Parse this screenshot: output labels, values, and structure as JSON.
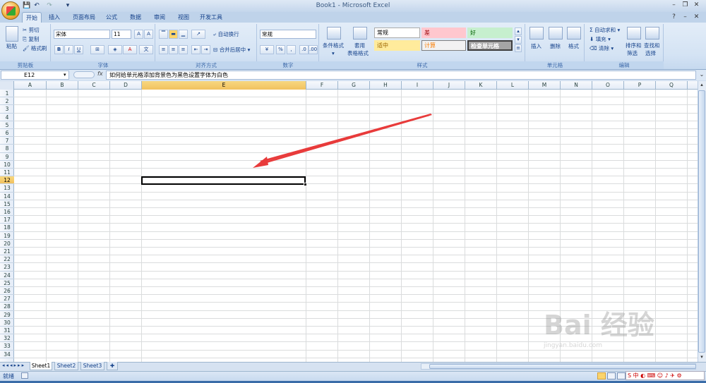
{
  "window": {
    "title": "Book1 - Microsoft Excel"
  },
  "tabs": [
    "开始",
    "插入",
    "页面布局",
    "公式",
    "数据",
    "审阅",
    "视图",
    "开发工具"
  ],
  "clipboard": {
    "paste": "粘贴",
    "cut": "剪切",
    "copy": "复制",
    "format_painter": "格式刷",
    "group_label": "剪贴板"
  },
  "font": {
    "name": "宋体",
    "size": "11",
    "bold": "B",
    "italic": "I",
    "underline": "U",
    "group_label": "字体"
  },
  "alignment": {
    "wrap_text": "自动换行",
    "merge_center": "合并后居中",
    "group_label": "对齐方式"
  },
  "number": {
    "format": "常规",
    "percent": "%",
    "comma": ",",
    "group_label": "数字"
  },
  "styles": {
    "conditional": "条件格式",
    "table_format_1": "套用",
    "table_format_2": "表格格式",
    "cells": [
      "常规",
      "差",
      "好",
      "适中",
      "计算",
      "检查单元格"
    ],
    "group_label": "样式"
  },
  "cells_group": {
    "insert": "插入",
    "delete": "删除",
    "format": "格式",
    "group_label": "单元格"
  },
  "editing": {
    "autosum": "自动求和",
    "fill": "填充",
    "clear": "清除",
    "sort_1": "排序和",
    "sort_2": "筛选",
    "find_1": "查找和",
    "find_2": "选择",
    "group_label": "编辑"
  },
  "formula_bar": {
    "name_box": "E12",
    "fx": "fx",
    "content": "如何给单元格添加背景色为黑色设置字体为白色"
  },
  "columns": [
    "A",
    "B",
    "C",
    "D",
    "E",
    "F",
    "G",
    "H",
    "I",
    "J",
    "K",
    "L",
    "M",
    "N",
    "O",
    "P",
    "Q"
  ],
  "rows": [
    "1",
    "2",
    "3",
    "4",
    "5",
    "6",
    "7",
    "8",
    "9",
    "10",
    "11",
    "12",
    "13",
    "14",
    "15",
    "16",
    "17",
    "18",
    "19",
    "20",
    "21",
    "22",
    "23",
    "24",
    "25",
    "26",
    "27",
    "28",
    "29",
    "30",
    "31",
    "32",
    "33",
    "34"
  ],
  "sheets": [
    "Sheet1",
    "Sheet2",
    "Sheet3"
  ],
  "status": {
    "ready": "就绪"
  },
  "watermark": {
    "brand": "Bai 经验",
    "url": "jingyan.baidu.com"
  },
  "colors": {
    "selected_header": "#f1c15f",
    "arrow": "#e83b3b",
    "ribbon": "#dbe6f4"
  }
}
